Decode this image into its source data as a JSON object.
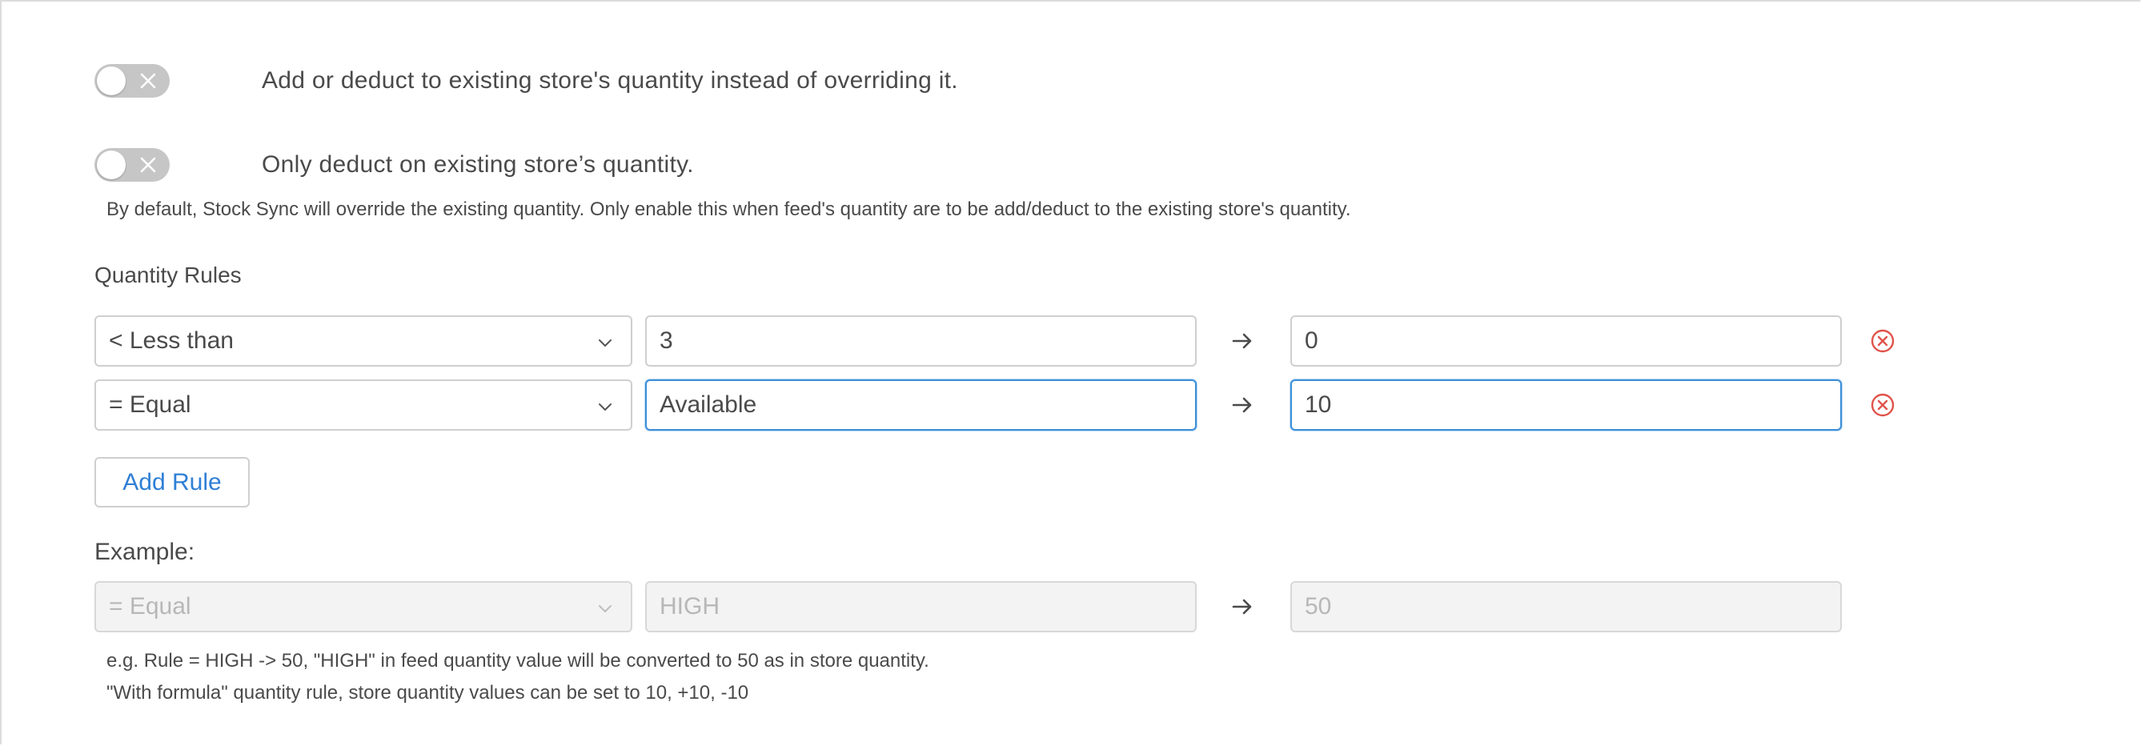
{
  "toggles": [
    {
      "label": "Add or deduct to existing store's quantity instead of overriding it.",
      "enabled": false
    },
    {
      "label": "Only deduct on existing store’s quantity.",
      "enabled": false
    }
  ],
  "help_text": "By default, Stock Sync will override the existing quantity. Only enable this when feed's quantity are to be add/deduct to the existing store's quantity.",
  "quantity_rules": {
    "title": "Quantity Rules",
    "rules": [
      {
        "operator": "< Less than",
        "value": "3",
        "result": "0"
      },
      {
        "operator": "= Equal",
        "value": "Available",
        "result": "10"
      }
    ],
    "add_rule_label": "Add Rule"
  },
  "example": {
    "label": "Example:",
    "operator": "= Equal",
    "value": "HIGH",
    "result": "50",
    "notes": [
      "e.g. Rule = HIGH -> 50, \"HIGH\" in feed quantity value will be converted to 50 as in store quantity.",
      "\"With formula\" quantity rule, store quantity values can be set to 10, +10, -10"
    ]
  },
  "icons": {
    "toggle_off": "x-icon",
    "dropdown": "chevron-down-icon",
    "maps_to": "arrow-right-icon",
    "remove": "remove-circle-icon"
  },
  "colors": {
    "accent": "#2f7fd6",
    "focus_border": "#3d8fd9",
    "remove": "#e0534a",
    "toggle_off": "#c6c6c6"
  }
}
